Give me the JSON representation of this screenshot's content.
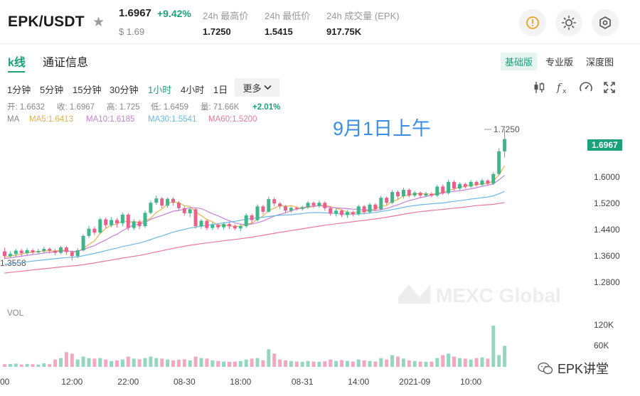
{
  "ticker": {
    "pair": "EPK/USDT",
    "price": "1.6967",
    "change": "+9.42%",
    "price_usd": "$ 1.69",
    "stats": [
      {
        "label": "24h 最高价",
        "value": "1.7250"
      },
      {
        "label": "24h 最低价",
        "value": "1.5415"
      },
      {
        "label": "24h 成交量 (EPK)",
        "value": "917.75K"
      }
    ]
  },
  "tabs": [
    "k线",
    "通证信息"
  ],
  "versions": [
    "基础版",
    "专业版",
    "深度图"
  ],
  "intervals": [
    "1分钟",
    "5分钟",
    "15分钟",
    "30分钟",
    "1小时",
    "4小时",
    "1日"
  ],
  "more_label": "更多",
  "ohlc_row": {
    "open": "开: 1.6632",
    "close": "收: 1.6967",
    "high": "高: 1.725",
    "low": "低: 1.6459",
    "volume": "量: 71.66K",
    "change": "+2.01%"
  },
  "ma_row": {
    "label": "MA",
    "ma5": "MA5:1.6413",
    "ma10": "MA10:1.6185",
    "ma30": "MA30:1.5541",
    "ma60": "MA60:1.5200"
  },
  "annotation": "9月1日上午",
  "watermark": "MEXC Global",
  "vol_label": "VOL",
  "footer_brand": "EPK讲堂",
  "colors": {
    "up": "#3db68c",
    "down": "#e9608a",
    "ma5": "#e6b34e",
    "ma10": "#c77fd6",
    "ma30": "#6db8e6",
    "ma60": "#e9789a",
    "accent": "#1ba27a"
  },
  "chart_data": {
    "type": "candlestick",
    "price_axis": {
      "ticks": [
        "1.6000",
        "1.5200",
        "1.4400",
        "1.3600",
        "1.2800"
      ],
      "range": [
        1.238,
        1.795
      ]
    },
    "current_price_tag": "1.6967",
    "max_label": "1.7250",
    "min_label": "1.3558",
    "volume_axis": {
      "ticks": [
        "120K",
        "60K"
      ],
      "max": 150000
    },
    "x_ticks": [
      {
        "label": "00",
        "index": 0
      },
      {
        "label": "12:00",
        "index": 12
      },
      {
        "label": "22:00",
        "index": 22
      },
      {
        "label": "08-30",
        "index": 32
      },
      {
        "label": "18:00",
        "index": 42
      },
      {
        "label": "08-31",
        "index": 53
      },
      {
        "label": "14:00",
        "index": 63
      },
      {
        "label": "2021-09",
        "index": 73
      },
      {
        "label": "10:00",
        "index": 83
      }
    ],
    "candles": [
      [
        1.385,
        1.372,
        1.395,
        1.365,
        9000
      ],
      [
        1.372,
        1.378,
        1.385,
        1.368,
        10000
      ],
      [
        1.378,
        1.387,
        1.392,
        1.37,
        11000
      ],
      [
        1.387,
        1.38,
        1.392,
        1.372,
        8000
      ],
      [
        1.38,
        1.388,
        1.394,
        1.375,
        10000
      ],
      [
        1.388,
        1.382,
        1.393,
        1.376,
        9000
      ],
      [
        1.382,
        1.386,
        1.392,
        1.377,
        8000
      ],
      [
        1.386,
        1.392,
        1.398,
        1.38,
        12000
      ],
      [
        1.392,
        1.387,
        1.396,
        1.379,
        9000
      ],
      [
        1.387,
        1.381,
        1.392,
        1.374,
        25000
      ],
      [
        1.381,
        1.396,
        1.4,
        1.377,
        30000
      ],
      [
        1.396,
        1.383,
        1.4,
        1.375,
        50000
      ],
      [
        1.383,
        1.372,
        1.388,
        1.36,
        45000
      ],
      [
        1.372,
        1.388,
        1.394,
        1.366,
        25000
      ],
      [
        1.388,
        1.428,
        1.432,
        1.384,
        35000
      ],
      [
        1.428,
        1.448,
        1.456,
        1.422,
        30000
      ],
      [
        1.448,
        1.437,
        1.454,
        1.43,
        28000
      ],
      [
        1.437,
        1.474,
        1.479,
        1.433,
        30000
      ],
      [
        1.474,
        1.458,
        1.479,
        1.45,
        25000
      ],
      [
        1.458,
        1.472,
        1.48,
        1.452,
        20000
      ],
      [
        1.472,
        1.463,
        1.478,
        1.451,
        22000
      ],
      [
        1.463,
        1.487,
        1.493,
        1.455,
        25000
      ],
      [
        1.487,
        1.45,
        1.492,
        1.443,
        35000
      ],
      [
        1.45,
        1.468,
        1.474,
        1.444,
        28000
      ],
      [
        1.468,
        1.455,
        1.473,
        1.447,
        26000
      ],
      [
        1.455,
        1.492,
        1.498,
        1.45,
        30000
      ],
      [
        1.492,
        1.52,
        1.526,
        1.488,
        35000
      ],
      [
        1.52,
        1.532,
        1.54,
        1.514,
        30000
      ],
      [
        1.532,
        1.512,
        1.536,
        1.505,
        28000
      ],
      [
        1.512,
        1.531,
        1.535,
        1.506,
        25000
      ],
      [
        1.531,
        1.52,
        1.535,
        1.512,
        22000
      ],
      [
        1.52,
        1.505,
        1.525,
        1.498,
        24000
      ],
      [
        1.505,
        1.491,
        1.51,
        1.484,
        26000
      ],
      [
        1.491,
        1.502,
        1.507,
        1.48,
        22000
      ],
      [
        1.502,
        1.455,
        1.506,
        1.448,
        35000
      ],
      [
        1.455,
        1.47,
        1.474,
        1.448,
        30000
      ],
      [
        1.47,
        1.45,
        1.474,
        1.444,
        28000
      ],
      [
        1.45,
        1.459,
        1.465,
        1.444,
        22000
      ],
      [
        1.459,
        1.452,
        1.463,
        1.446,
        20000
      ],
      [
        1.452,
        1.461,
        1.466,
        1.446,
        18000
      ],
      [
        1.461,
        1.455,
        1.465,
        1.447,
        17000
      ],
      [
        1.455,
        1.449,
        1.46,
        1.444,
        18000
      ],
      [
        1.449,
        1.455,
        1.46,
        1.441,
        20000
      ],
      [
        1.455,
        1.485,
        1.49,
        1.45,
        25000
      ],
      [
        1.485,
        1.472,
        1.49,
        1.462,
        28000
      ],
      [
        1.472,
        1.51,
        1.516,
        1.468,
        30000
      ],
      [
        1.51,
        1.495,
        1.515,
        1.488,
        22000
      ],
      [
        1.495,
        1.53,
        1.537,
        1.492,
        60000
      ],
      [
        1.53,
        1.518,
        1.535,
        1.51,
        45000
      ],
      [
        1.518,
        1.51,
        1.522,
        1.503,
        25000
      ],
      [
        1.51,
        1.498,
        1.514,
        1.492,
        22000
      ],
      [
        1.498,
        1.506,
        1.511,
        1.493,
        20000
      ],
      [
        1.506,
        1.503,
        1.51,
        1.498,
        18000
      ],
      [
        1.503,
        1.508,
        1.512,
        1.498,
        17000
      ],
      [
        1.508,
        1.52,
        1.525,
        1.503,
        20000
      ],
      [
        1.52,
        1.512,
        1.524,
        1.506,
        18000
      ],
      [
        1.512,
        1.52,
        1.526,
        1.506,
        17000
      ],
      [
        1.52,
        1.505,
        1.524,
        1.498,
        19000
      ],
      [
        1.505,
        1.49,
        1.508,
        1.484,
        25000
      ],
      [
        1.49,
        1.498,
        1.504,
        1.482,
        20000
      ],
      [
        1.498,
        1.486,
        1.502,
        1.48,
        23000
      ],
      [
        1.486,
        1.494,
        1.5,
        1.478,
        20000
      ],
      [
        1.494,
        1.488,
        1.498,
        1.482,
        18000
      ],
      [
        1.488,
        1.51,
        1.515,
        1.484,
        25000
      ],
      [
        1.51,
        1.494,
        1.514,
        1.488,
        22000
      ],
      [
        1.494,
        1.515,
        1.52,
        1.49,
        20000
      ],
      [
        1.515,
        1.502,
        1.519,
        1.498,
        18000
      ],
      [
        1.502,
        1.534,
        1.54,
        1.498,
        30000
      ],
      [
        1.534,
        1.52,
        1.538,
        1.514,
        25000
      ],
      [
        1.52,
        1.55,
        1.556,
        1.516,
        40000
      ],
      [
        1.55,
        1.538,
        1.555,
        1.53,
        35000
      ],
      [
        1.538,
        1.556,
        1.562,
        1.532,
        28000
      ],
      [
        1.556,
        1.54,
        1.56,
        1.535,
        22000
      ],
      [
        1.54,
        1.548,
        1.553,
        1.535,
        20000
      ],
      [
        1.548,
        1.54,
        1.552,
        1.534,
        18000
      ],
      [
        1.54,
        1.545,
        1.55,
        1.536,
        17000
      ],
      [
        1.545,
        1.54,
        1.549,
        1.535,
        18000
      ],
      [
        1.54,
        1.565,
        1.57,
        1.536,
        30000
      ],
      [
        1.565,
        1.547,
        1.571,
        1.542,
        40000
      ],
      [
        1.547,
        1.578,
        1.584,
        1.543,
        45000
      ],
      [
        1.578,
        1.56,
        1.582,
        1.554,
        35000
      ],
      [
        1.56,
        1.572,
        1.577,
        1.555,
        30000
      ],
      [
        1.572,
        1.565,
        1.576,
        1.56,
        28000
      ],
      [
        1.565,
        1.578,
        1.583,
        1.562,
        25000
      ],
      [
        1.578,
        1.57,
        1.582,
        1.565,
        30000
      ],
      [
        1.57,
        1.582,
        1.587,
        1.566,
        32000
      ],
      [
        1.582,
        1.573,
        1.586,
        1.568,
        28000
      ],
      [
        1.573,
        1.6,
        1.605,
        1.57,
        140000
      ],
      [
        1.6,
        1.663,
        1.672,
        1.596,
        40000
      ],
      [
        1.663,
        1.697,
        1.725,
        1.646,
        71660
      ]
    ]
  }
}
